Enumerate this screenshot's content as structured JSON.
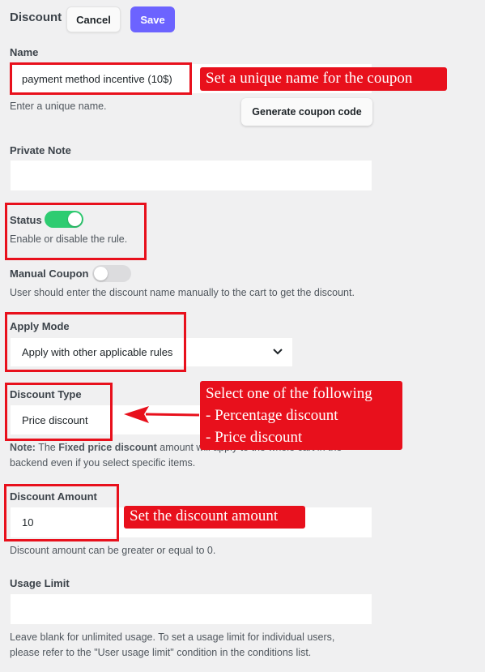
{
  "header": {
    "title": "Discount",
    "cancel_label": "Cancel",
    "save_label": "Save"
  },
  "name": {
    "label": "Name",
    "value": "payment method incentive (10$)",
    "help": "Enter a unique name.",
    "generate_label": "Generate coupon code"
  },
  "private_note": {
    "label": "Private Note",
    "value": ""
  },
  "status": {
    "label": "Status",
    "enabled": true,
    "help": "Enable or disable the rule."
  },
  "manual_coupon": {
    "label": "Manual Coupon",
    "enabled": false,
    "help": "User should enter the discount name manually to the cart to get the discount."
  },
  "apply_mode": {
    "label": "Apply Mode",
    "selected": "Apply with other applicable rules"
  },
  "discount_type": {
    "label": "Discount Type",
    "selected": "Price discount",
    "note_bold": "Note:",
    "note_text1": " The ",
    "note_bold2": "Fixed price discount",
    "note_text2": " amount will apply to the whole cart in the",
    "note_line2": "backend even if you select specific items."
  },
  "discount_amount": {
    "label": "Discount Amount",
    "value": "10",
    "help": "Discount amount can be greater or equal to 0."
  },
  "usage_limit": {
    "label": "Usage Limit",
    "value": "",
    "help_line1": "Leave blank for unlimited usage. To set a usage limit for individual users,",
    "help_line2": "please refer to the \"User usage limit\" condition in the conditions list."
  },
  "annotations": {
    "name_callout": "Set a unique name for the coupon",
    "type_callout_line1": "Select one of the following",
    "type_callout_line2": "- Percentage discount",
    "type_callout_line3": "- Price discount",
    "amount_callout": "Set the discount amount"
  },
  "colors": {
    "accent": "#6c63ff",
    "toggle_on": "#2ecc71",
    "toggle_off": "#dcdcde",
    "annotation_red": "#e8101c"
  },
  "icons": {
    "select_caret": "chevron-down-icon",
    "annotation_pointer": "arrow-left-icon"
  }
}
